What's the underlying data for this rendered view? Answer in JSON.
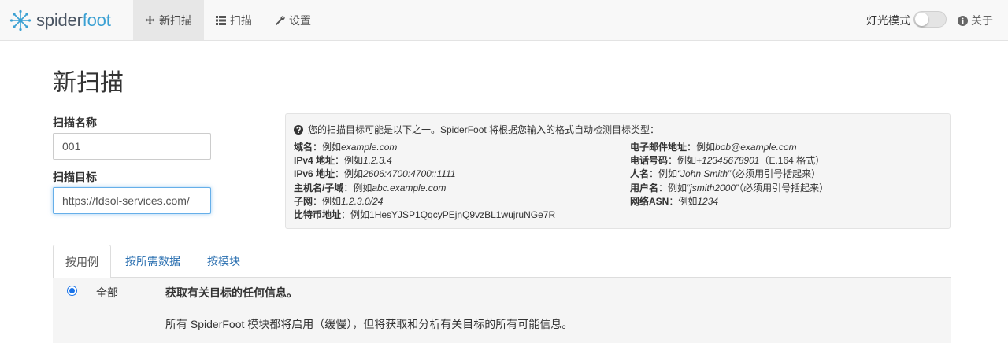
{
  "brand": {
    "name_part1": "spider",
    "name_part2": "foot"
  },
  "nav": {
    "new_scan": "新扫描",
    "scans": "扫描",
    "settings": "设置",
    "light_mode": "灯光模式",
    "about": "关于"
  },
  "page": {
    "title": "新扫描"
  },
  "form": {
    "scan_name_label": "扫描名称",
    "scan_name_value": "001",
    "scan_target_label": "扫描目标",
    "scan_target_value": "https://fdsol-services.com/"
  },
  "info": {
    "header": "您的扫描目标可能是以下之一。SpiderFoot 将根据您输入的格式自动检测目标类型：",
    "left": [
      {
        "label": "域名",
        "prefix": "：例如",
        "example": "example.com",
        "suffix": ""
      },
      {
        "label": "IPv4 地址",
        "prefix": "：例如",
        "example": "1.2.3.4",
        "suffix": ""
      },
      {
        "label": "IPv6 地址",
        "prefix": "：例如",
        "example": "2606:4700:4700::1111",
        "suffix": ""
      },
      {
        "label": "主机名/子域",
        "prefix": "：例如",
        "example": "abc.example.com",
        "suffix": ""
      },
      {
        "label": "子网",
        "prefix": "：例如",
        "example": "1.2.3.0/24",
        "suffix": ""
      },
      {
        "label": "比特币地址",
        "prefix": "：例如1HesYJSP1QqcyPEjnQ9vzBL1wujruNGe7R",
        "example": "",
        "suffix": ""
      }
    ],
    "right": [
      {
        "label": "电子邮件地址",
        "prefix": "：例如",
        "example": "bob@example.com",
        "suffix": ""
      },
      {
        "label": "电话号码",
        "prefix": "：例如",
        "example": "+12345678901",
        "suffix": "（E.164 格式）"
      },
      {
        "label": "人名",
        "prefix": "：例如",
        "example": "“John Smith”",
        "suffix": "（必须用引号括起来）"
      },
      {
        "label": "用户名",
        "prefix": "：例如",
        "example": "“jsmith2000”",
        "suffix": "（必须用引号括起来）"
      },
      {
        "label": "网络ASN",
        "prefix": "：例如",
        "example": "1234",
        "suffix": ""
      }
    ]
  },
  "tabs": {
    "by_use_case": "按用例",
    "by_required_data": "按所需数据",
    "by_module": "按模块"
  },
  "use_case": {
    "name": "全部",
    "heading": "获取有关目标的任何信息。",
    "description": "所有 SpiderFoot 模块都将启用（缓慢），但将获取和分析有关目标的所有可能信息。",
    "selected": true
  },
  "colors": {
    "accent": "#3aa0d3",
    "link": "#2a6fb0",
    "radio": "#1a73e8"
  },
  "icons": {
    "logo": "spiderfoot-logo-icon",
    "new_scan": "crosshairs-icon",
    "scans": "list-icon",
    "settings": "wrench-icon",
    "about": "info-circle-icon",
    "info": "question-circle-icon"
  }
}
